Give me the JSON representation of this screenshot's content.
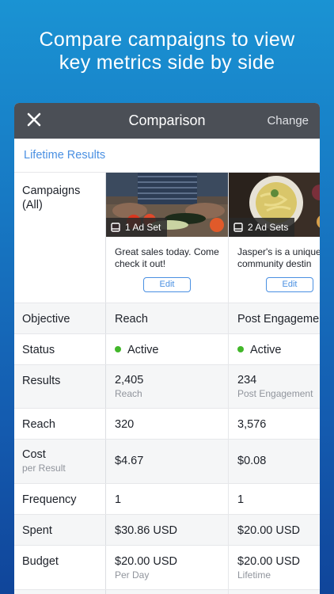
{
  "headline": {
    "line1": "Compare campaigns to view",
    "line2": "key metrics side by side"
  },
  "navbar": {
    "title": "Comparison",
    "change_label": "Change",
    "close_icon": "close-icon"
  },
  "lifetime_label": "Lifetime Results",
  "campaigns_label_line1": "Campaigns",
  "campaigns_label_line2": "(All)",
  "campaigns": [
    {
      "adsets": "1 Ad Set",
      "text": "Great sales today. Come check it out!",
      "edit": "Edit"
    },
    {
      "adsets": "2 Ad Sets",
      "text": "Jasper's is a unique community destin",
      "edit": "Edit"
    }
  ],
  "rows": [
    {
      "label": "Objective",
      "sublabel": "",
      "values": [
        {
          "main": "Reach",
          "sub": ""
        },
        {
          "main": "Post Engagement",
          "sub": ""
        }
      ]
    },
    {
      "label": "Status",
      "sublabel": "",
      "values": [
        {
          "main": "Active",
          "sub": ""
        },
        {
          "main": "Active",
          "sub": ""
        }
      ]
    },
    {
      "label": "Results",
      "sublabel": "",
      "values": [
        {
          "main": "2,405",
          "sub": "Reach"
        },
        {
          "main": "234",
          "sub": "Post Engagement"
        }
      ]
    },
    {
      "label": "Reach",
      "sublabel": "",
      "values": [
        {
          "main": "320",
          "sub": ""
        },
        {
          "main": "3,576",
          "sub": ""
        }
      ]
    },
    {
      "label": "Cost",
      "sublabel": "per Result",
      "values": [
        {
          "main": "$4.67",
          "sub": ""
        },
        {
          "main": "$0.08",
          "sub": ""
        }
      ]
    },
    {
      "label": "Frequency",
      "sublabel": "",
      "values": [
        {
          "main": "1",
          "sub": ""
        },
        {
          "main": "1",
          "sub": ""
        }
      ]
    },
    {
      "label": "Spent",
      "sublabel": "",
      "values": [
        {
          "main": "$30.86 USD",
          "sub": ""
        },
        {
          "main": "$20.00 USD",
          "sub": ""
        }
      ]
    },
    {
      "label": "Budget",
      "sublabel": "",
      "values": [
        {
          "main": "$20.00 USD",
          "sub": "Per Day"
        },
        {
          "main": "$20.00 USD",
          "sub": "Lifetime"
        }
      ]
    }
  ],
  "colors": {
    "accent": "#4a90e2",
    "active_dot": "#42b72a",
    "navbar": "#4b4f56"
  }
}
